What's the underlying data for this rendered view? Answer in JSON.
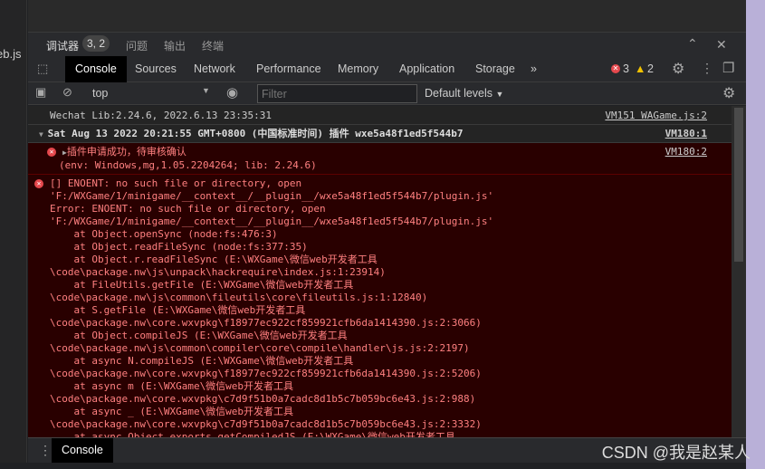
{
  "left_file": "eb.js",
  "panel_tabs": [
    {
      "label": "调试器",
      "badge": "3, 2"
    },
    {
      "label": "问题"
    },
    {
      "label": "输出"
    },
    {
      "label": "终端"
    }
  ],
  "tabs": [
    "Console",
    "Sources",
    "Network",
    "Performance",
    "Memory",
    "Application",
    "Storage"
  ],
  "counts": {
    "errors": "3",
    "warnings": "2"
  },
  "toolbar": {
    "context": "top",
    "filter_placeholder": "Filter",
    "levels": "Default levels"
  },
  "messages": {
    "m1": {
      "text": "Wechat Lib:2.24.6, 2022.6.13 23:35:31",
      "source": "VM151 WAGame.js:2"
    },
    "m2": {
      "text": "Sat Aug 13 2022 20:21:55 GMT+0800 (中国标准时间) 插件 wxe5a48f1ed5f544b7",
      "source": "VM180:1"
    },
    "m3": {
      "text": "插件申请成功，待审核确认",
      "sub": "(env: Windows,mg,1.05.2204264; lib: 2.24.6)",
      "source": "VM180:2"
    },
    "m4": {
      "lines": [
        "[] ENOENT: no such file or directory, open",
        "'F:/WXGame/1/minigame/__context__/__plugin__/wxe5a48f1ed5f544b7/plugin.js'",
        "Error: ENOENT: no such file or directory, open",
        "'F:/WXGame/1/minigame/__context__/__plugin__/wxe5a48f1ed5f544b7/plugin.js'",
        "    at Object.openSync (node:fs:476:3)",
        "    at Object.readFileSync (node:fs:377:35)",
        "    at Object.r.readFileSync (E:\\WXGame\\微信web开发者工具",
        "\\code\\package.nw\\js\\unpack\\hackrequire\\index.js:1:23914)",
        "    at FileUtils.getFile (E:\\WXGame\\微信web开发者工具",
        "\\code\\package.nw\\js\\common\\fileutils\\core\\fileutils.js:1:12840)",
        "    at S.getFile (E:\\WXGame\\微信web开发者工具",
        "\\code\\package.nw\\core.wxvpkg\\f18977ec922cf859921cfb6da1414390.js:2:3066)",
        "    at Object.compileJS (E:\\WXGame\\微信web开发者工具",
        "\\code\\package.nw\\js\\common\\compiler\\core\\compile\\handler\\js.js:2:2197)",
        "    at async N.compileJS (E:\\WXGame\\微信web开发者工具",
        "\\code\\package.nw\\core.wxvpkg\\f18977ec922cf859921cfb6da1414390.js:2:5206)",
        "    at async m (E:\\WXGame\\微信web开发者工具",
        "\\code\\package.nw\\core.wxvpkg\\c7d9f51b0a7cadc8d1b5c7b059bc6e43.js:2:988)",
        "    at async _ (E:\\WXGame\\微信web开发者工具",
        "\\code\\package.nw\\core.wxvpkg\\c7d9f51b0a7cadc8d1b5c7b059bc6e43.js:2:3332)",
        "    at async Object.exports.getCompiledJS (E:\\WXGame\\微信web开发者工具"
      ]
    }
  },
  "drawer": {
    "tab": "Console"
  },
  "watermark": "CSDN @我是赵某人"
}
